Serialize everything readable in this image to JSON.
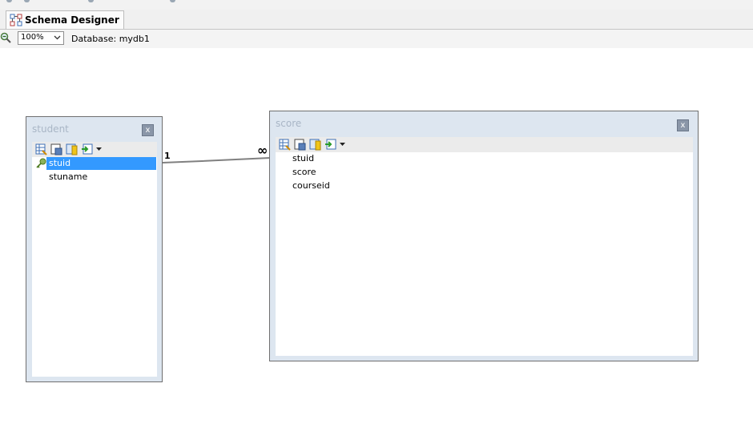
{
  "tab": {
    "label": "Schema Designer",
    "icon": "schema-designer-icon"
  },
  "options": {
    "zoom": "100%",
    "database_label": "Database: mydb1"
  },
  "colors": {
    "selection": "#3399ff",
    "window_frame": "#dde6f0",
    "window_title": "#a9b6c6"
  },
  "tables": {
    "student": {
      "title": "student",
      "close": "x",
      "fields": [
        "stuid",
        "stuname"
      ],
      "primary_key": "stuid",
      "selected": "stuid"
    },
    "score": {
      "title": "score",
      "close": "x",
      "fields": [
        "stuid",
        "score",
        "courseid"
      ]
    }
  },
  "relation": {
    "from_label": "1",
    "to_label": "∞"
  }
}
